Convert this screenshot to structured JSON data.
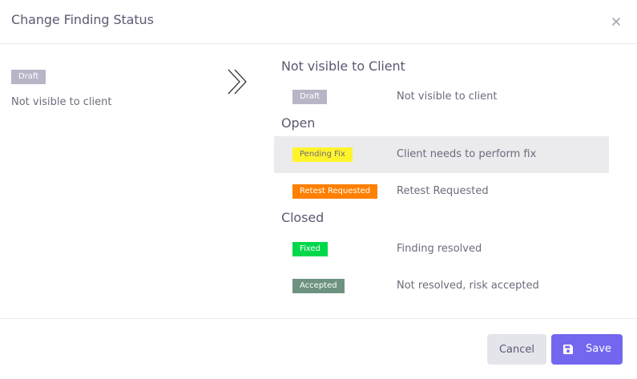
{
  "modal": {
    "title": "Change Finding Status",
    "close_icon": "close-icon"
  },
  "current": {
    "badge": {
      "label": "Draft",
      "bg": "#b8b5c7",
      "fg": "#ffffff"
    },
    "description": "Not visible to client"
  },
  "arrow_icon": "double-chevron-right-icon",
  "groups": [
    {
      "title": "Not visible to Client",
      "options": [
        {
          "badge": {
            "label": "Draft",
            "bg": "#b8b5c7",
            "fg": "#ffffff"
          },
          "description": "Not visible to client",
          "selected": false
        }
      ]
    },
    {
      "title": "Open",
      "options": [
        {
          "badge": {
            "label": "Pending Fix",
            "bg": "#fff42b",
            "fg": "#6e6b7b"
          },
          "description": "Client needs to perform fix",
          "selected": true
        },
        {
          "badge": {
            "label": "Retest Requested",
            "bg": "#ff8000",
            "fg": "#ffffff"
          },
          "description": "Retest Requested",
          "selected": false
        }
      ]
    },
    {
      "title": "Closed",
      "options": [
        {
          "badge": {
            "label": "Fixed",
            "bg": "#00d84a",
            "fg": "#ffffff"
          },
          "description": "Finding resolved",
          "selected": false
        },
        {
          "badge": {
            "label": "Accepted",
            "bg": "#6d9380",
            "fg": "#ffffff"
          },
          "description": "Not resolved, risk accepted",
          "selected": false
        }
      ]
    }
  ],
  "footer": {
    "cancel_label": "Cancel",
    "save_label": "Save",
    "save_icon": "save-icon"
  },
  "colors": {
    "accent": "#7367f0",
    "selected_row": "#ebeaed"
  }
}
